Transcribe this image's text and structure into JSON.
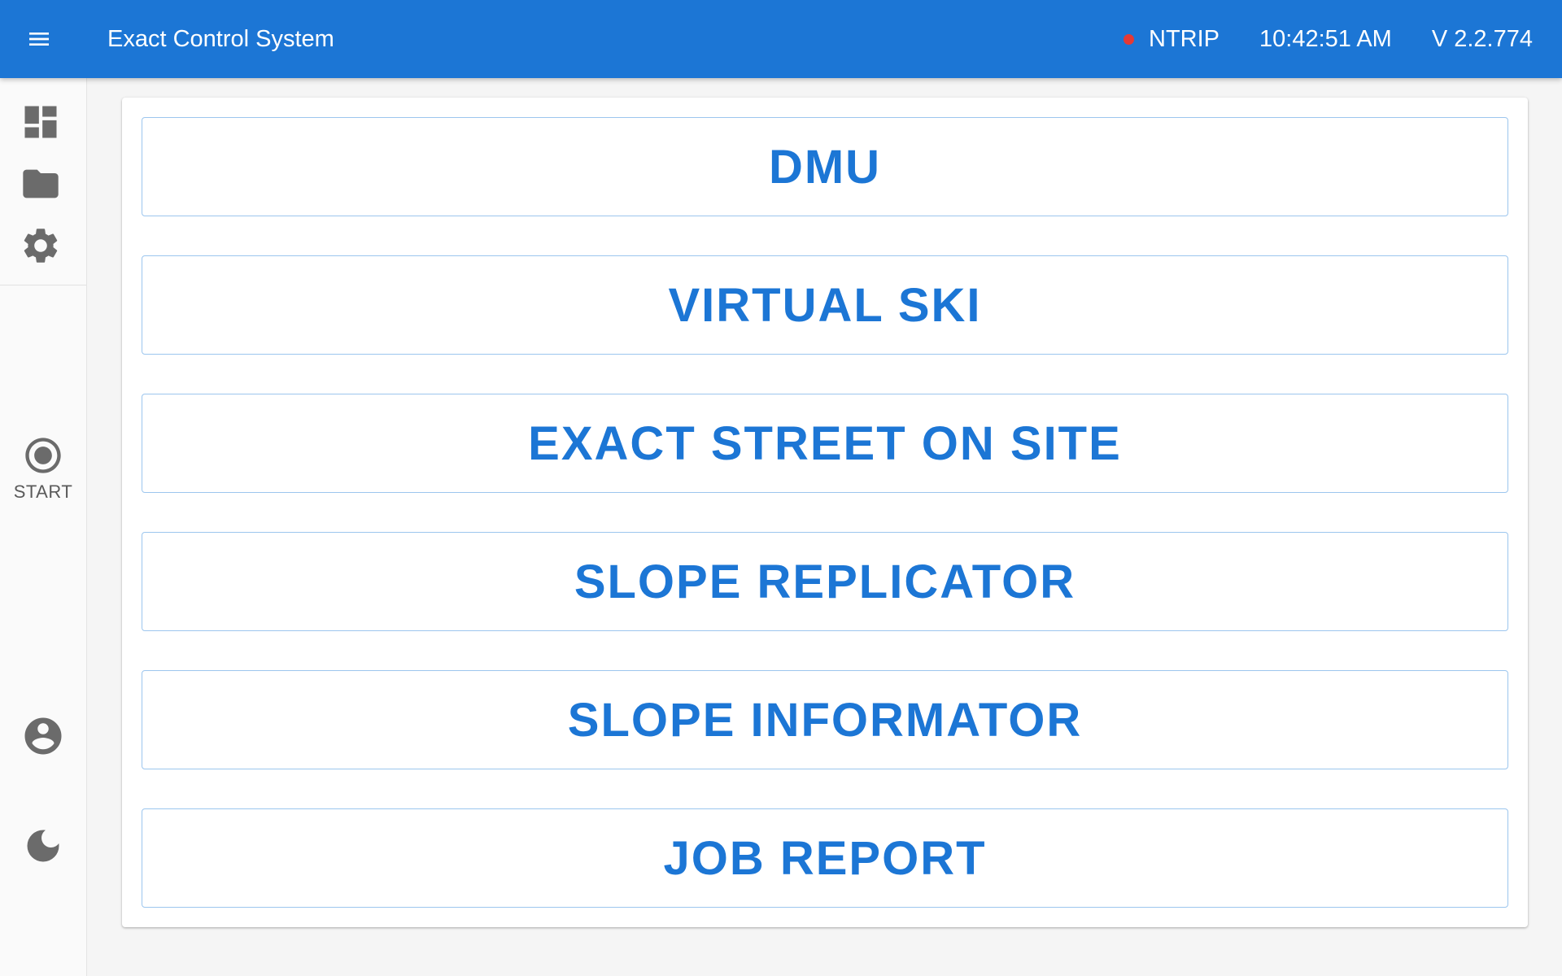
{
  "header": {
    "title": "Exact Control System",
    "status_label": "NTRIP",
    "status_color": "#e53935",
    "time": "10:42:51 AM",
    "version": "V 2.2.774"
  },
  "rail": {
    "icons": [
      "dashboard-icon",
      "folder-icon",
      "gear-icon",
      "record-icon",
      "account-icon",
      "moon-icon"
    ],
    "start_label": "START"
  },
  "menu": {
    "items": [
      {
        "label": "DMU"
      },
      {
        "label": "VIRTUAL SKI"
      },
      {
        "label": "EXACT STREET ON SITE"
      },
      {
        "label": "SLOPE REPLICATOR"
      },
      {
        "label": "SLOPE INFORMATOR"
      },
      {
        "label": "JOB REPORT"
      }
    ]
  },
  "colors": {
    "primary": "#1c76d5",
    "border": "#9cc6ee",
    "icon": "#6b6b6b"
  }
}
